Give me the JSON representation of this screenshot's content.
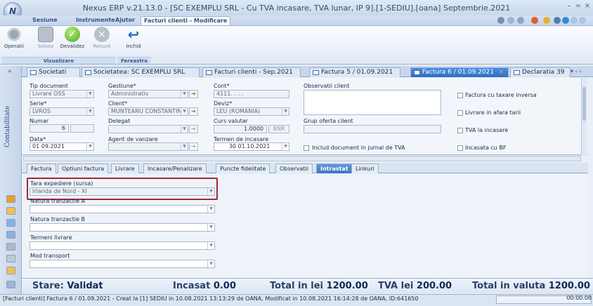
{
  "window": {
    "title": "Nexus ERP v.21.13.0 - [SC EXEMPLU SRL - Cu TVA incasare, TVA lunar, IP 9].[1-SEDIU].[oana] Septembrie.2021",
    "logo_letter": "N",
    "controls": {
      "minimize": "–",
      "restore": "=",
      "close": "×"
    }
  },
  "menu": {
    "items": [
      "Sesiune",
      "Instrumente",
      "Ajutor"
    ],
    "active": "Facturi clienti - Modificare"
  },
  "ribbon": {
    "buttons": {
      "operatii": "Operatii",
      "salvez": "Salvez",
      "devalidez": "Devalidez",
      "renunt": "Renunt",
      "inchid": "Inchid"
    },
    "groups": {
      "vizualizare": "Vizualizare",
      "fereastra": "Fereastra"
    }
  },
  "sidebar": {
    "vertical_label": "Contabilitate",
    "collapse": "»"
  },
  "doc_tabs": {
    "items": [
      "Societati",
      "Societatea: SC EXEMPLU SRL",
      "Facturi clienti - Sep.2021",
      "Factura 5 / 01.09.2021",
      "Factura 6 / 01.09.2021",
      "Declaratia 39"
    ],
    "active_index": 4,
    "active_close": "×",
    "nav": "▾ ‹ ›"
  },
  "form": {
    "tip_document": {
      "label": "Tip document",
      "value": "Livrare OSS"
    },
    "serie": {
      "label": "Serie*",
      "value": "LVROS"
    },
    "numar": {
      "label": "Numar",
      "value": "6"
    },
    "data": {
      "label": "Data*",
      "value": "01 09.2021"
    },
    "gestiune": {
      "label": "Gestiune*",
      "value": "Administrativ"
    },
    "client": {
      "label": "Client*",
      "value": "MUNTEANU CONSTANTIN"
    },
    "delegat": {
      "label": "Delegat",
      "value": ""
    },
    "agent": {
      "label": "Agent de vanzare",
      "value": ""
    },
    "cont": {
      "label": "Cont*",
      "value": "4111. .  .  ."
    },
    "deviz": {
      "label": "Deviz*",
      "value": "LEU (ROMANIA)"
    },
    "curs": {
      "label": "Curs valutar",
      "value": "1.0000",
      "btn": "BNR"
    },
    "termen": {
      "label": "Termen de incasare",
      "days": "30",
      "date": "01.10.2021"
    },
    "observatii": {
      "label": "Observatii client",
      "value": ""
    },
    "grup_oferta": {
      "label": "Grup oferta client",
      "value": ""
    },
    "include_jurnal": "Includ document in jurnal de TVA",
    "checks": {
      "taxare_inversa": "Factura cu taxare inversa",
      "afara_tarii": "Livrare in afara tarii",
      "tva_incasare": "TVA la incasare",
      "incasata_bf": "Incasata cu BF"
    }
  },
  "sub_tabs": {
    "items": [
      "Factura",
      "Optiuni factura",
      "Livrare",
      "Incasare/Penalizare",
      "Puncte fidelitate",
      "Observatii",
      "Intrastat",
      "Linkuri"
    ],
    "active_index": 6
  },
  "intrastat": {
    "tara_expediere": {
      "label": "Tara expediere (sursa)",
      "value": "Irlanda de Nord - XI"
    },
    "natura_a": {
      "label": "Natura tranzactie A",
      "value": ""
    },
    "natura_b": {
      "label": "Natura tranzactie B",
      "value": ""
    },
    "termeni": {
      "label": "Termeni livrare",
      "value": ""
    },
    "mod_transport": {
      "label": "Mod transport",
      "value": ""
    }
  },
  "status": {
    "stare_label": "Stare:",
    "stare_value": "Validat",
    "incasat_label": "Incasat",
    "incasat_value": "0.00",
    "total_lei_label": "Total in lei",
    "total_lei_value": "1200.00",
    "tva_label": "TVA lei",
    "tva_value": "200.00",
    "total_valuta_label": "Total in valuta",
    "total_valuta_value": "1200.00"
  },
  "footer": {
    "text": "[Facturi clienti] Factura 6 / 01.09.2021 - Creat la [1] SEDIU  in 10.08.2021 13:13:29 de OANA,  Modificat in 10.08.2021 16:14:28 de OANA, ID:641650",
    "elapsed": "00:00.08"
  }
}
